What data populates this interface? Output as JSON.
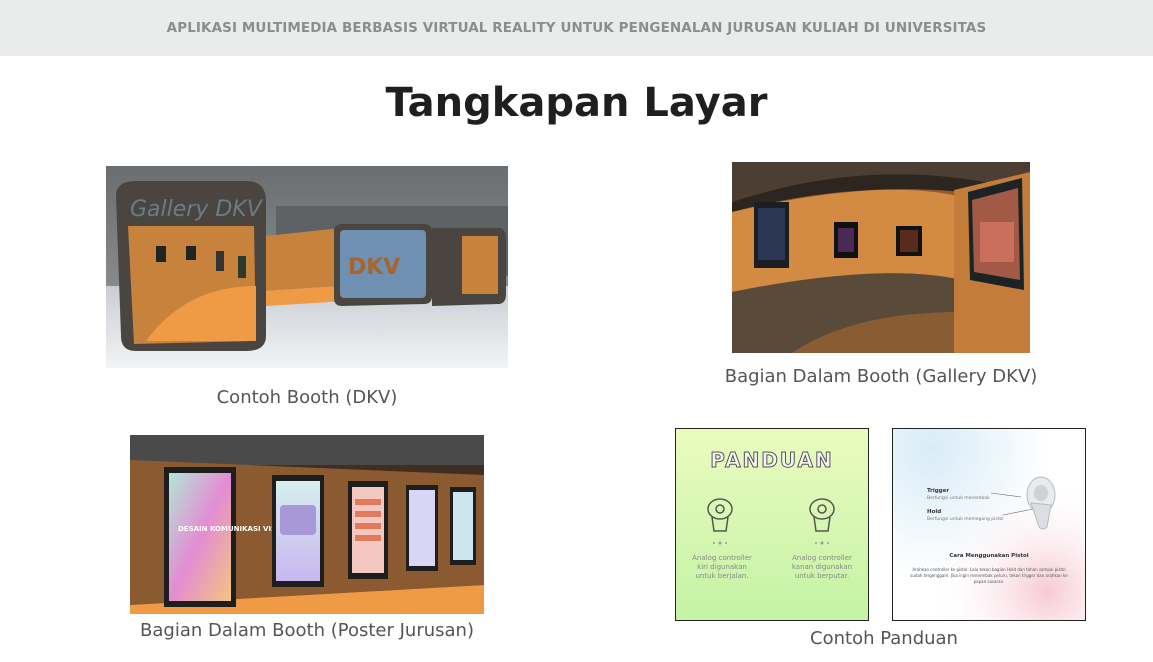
{
  "header": {
    "text": "APLIKASI MULTIMEDIA BERBASIS VIRTUAL REALITY UNTUK PENGENALAN JURUSAN KULIAH DI UNIVERSITAS"
  },
  "page": {
    "title": "Tangkapan Layar"
  },
  "screenshots": [
    {
      "caption": "Contoh Booth (DKV)",
      "sign_text": "Gallery DKV",
      "booth_text": "DKV"
    },
    {
      "caption": "Bagian Dalam Booth (Gallery DKV)"
    },
    {
      "caption": "Bagian Dalam Booth (Poster Jurusan)",
      "poster_text": "DESAIN KOMUNIKASI VISUAL"
    },
    {
      "caption": "Contoh Panduan"
    }
  ],
  "guide": {
    "left": {
      "title": "PANDUAN",
      "analog_left": [
        "Analog controller",
        "kiri digunakan",
        "untuk berjalan."
      ],
      "analog_right": [
        "Analog controller",
        "kanan digunakan",
        "untuk berputar."
      ]
    },
    "right": {
      "trigger_label": "Trigger",
      "trigger_desc": "Berfungsi untuk menembak",
      "hold_label": "Hold",
      "hold_desc": "Berfungsi untuk memegang pistol",
      "heading": "Cara Menggunakan Pistol",
      "body": [
        "Arahkan controller ke pistol. Lalu tekan bagian Hold dan tahan sampai pistol",
        "sudah tergenggam. Jika ingin menembak peluru, tekan trigger dan arahkan ke",
        "papan sasaran."
      ]
    }
  },
  "colors": {
    "topbar_bg": "#e9eceb",
    "booth_orange": "#d98a3c",
    "floor_orange": "#ef9a45"
  }
}
